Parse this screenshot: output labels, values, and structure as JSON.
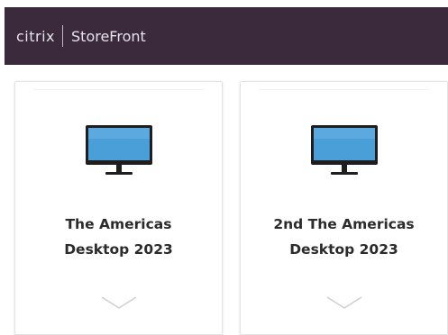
{
  "header": {
    "logo_text": "citrix",
    "app_title": "StoreFront",
    "background_color": "#3a2a3b"
  },
  "apps": [
    {
      "name": "The Americas\nDesktop 2023",
      "icon": "desktop-monitor-icon",
      "expand_icon": "chevron-down-icon"
    },
    {
      "name": "2nd The Americas\nDesktop 2023",
      "icon": "desktop-monitor-icon",
      "expand_icon": "chevron-down-icon"
    }
  ],
  "colors": {
    "monitor_screen": "#4a9fd8",
    "monitor_frame": "#1e1e1e"
  }
}
